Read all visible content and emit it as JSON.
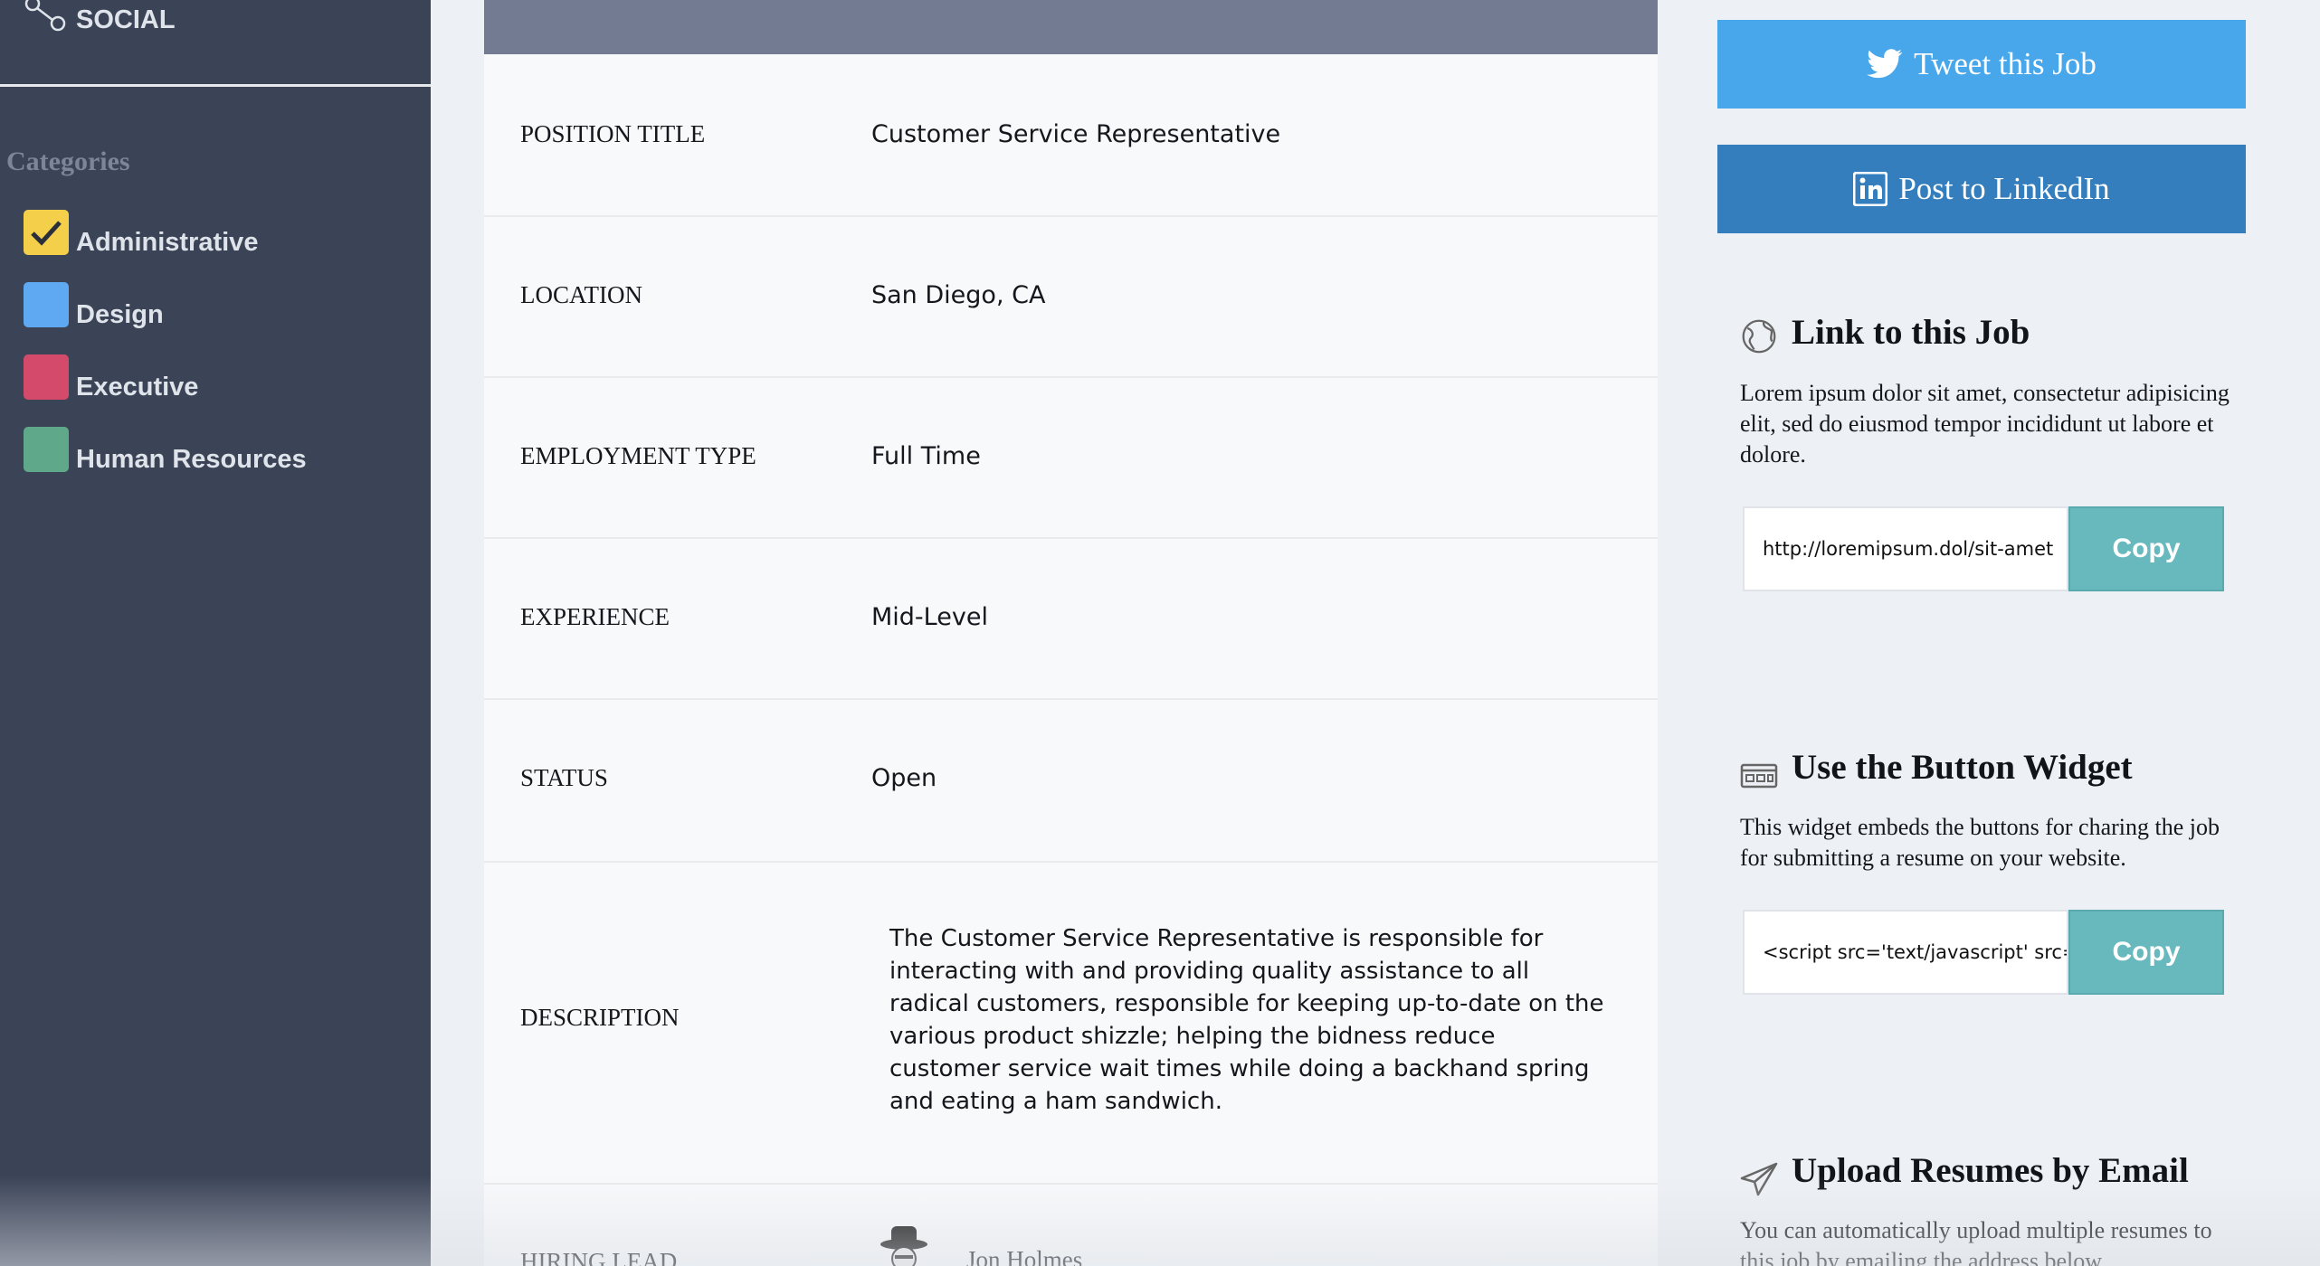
{
  "sidebar": {
    "social_label": "SOCIAL",
    "categories_title": "Categories",
    "categories": [
      {
        "label": "Administrative",
        "color": "#f4d04a",
        "checked": true
      },
      {
        "label": "Design",
        "color": "#5ea9f2",
        "checked": false
      },
      {
        "label": "Executive",
        "color": "#d44a6a",
        "checked": false
      },
      {
        "label": "Human Resources",
        "color": "#5fa98a",
        "checked": false
      }
    ]
  },
  "job": {
    "fields": [
      {
        "label": "POSITION TITLE",
        "value": "Customer Service Representative"
      },
      {
        "label": "LOCATION",
        "value": "San Diego, CA"
      },
      {
        "label": "EMPLOYMENT TYPE",
        "value": "Full Time"
      },
      {
        "label": "EXPERIENCE",
        "value": "Mid-Level"
      },
      {
        "label": "STATUS",
        "value": "Open"
      }
    ],
    "description_label": "DESCRIPTION",
    "description": "The Customer Service Representative is responsible for interacting with and providing quality assistance to all radical customers, responsible for keeping up-to-date on the various product shizzle; helping the bidness reduce customer service wait times while doing a backhand spring and eating a ham sandwich.",
    "hiring_lead_label": "HIRING LEAD",
    "hiring_lead_name": "Jon Holmes"
  },
  "share": {
    "tweet_label": "Tweet this Job",
    "linkedin_label": "Post to LinkedIn"
  },
  "link_section": {
    "title": "Link to this Job",
    "text": "Lorem ipsum dolor sit amet, consectetur adipisicing elit, sed do eiusmod tempor incididunt ut labore et dolore.",
    "field_value": "http://loremipsum.dol/sit-amet",
    "copy_label": "Copy",
    "icon": "globe-icon"
  },
  "widget_section": {
    "title": "Use the Button Widget",
    "text": "This widget embeds the buttons for charing the job for submitting a resume on your website.",
    "field_value": "<script src='text/javascript' src='widget.js'>",
    "copy_label": "Copy",
    "icon": "widget-icon"
  },
  "email_section": {
    "title": "Upload Resumes by Email",
    "text": "You can automatically upload multiple resumes to this job by emailing the address below.",
    "icon": "paper-plane-icon"
  },
  "colors": {
    "sidebar_bg": "#3b4357",
    "header_bar": "#727b92",
    "twitter": "#48a6ea",
    "linkedin": "#347ebd",
    "copy_button": "#68b9bd"
  }
}
